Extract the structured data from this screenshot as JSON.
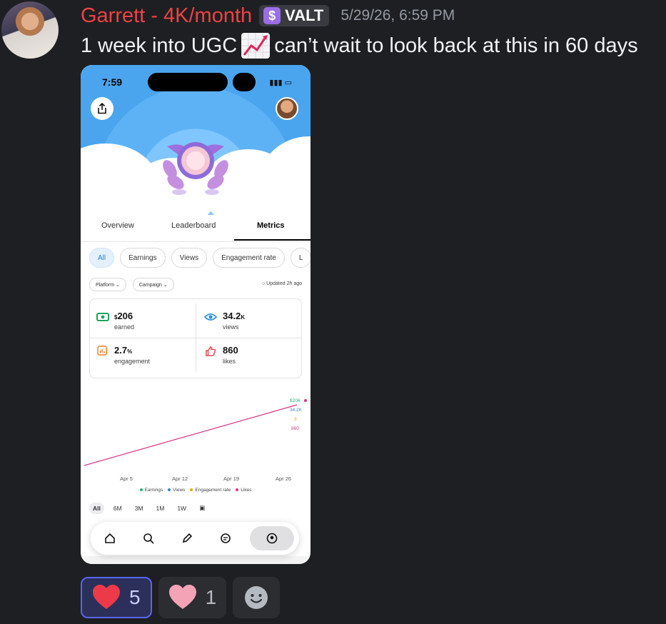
{
  "author": {
    "name": "Garrett - 4K/month",
    "tag": "VALT",
    "tag_icon": "server-tag-icon",
    "timestamp": "5/29/26, 6:59 PM"
  },
  "message": {
    "text_before": "1 week into UGC",
    "emoji": "chart-increasing-emoji",
    "text_after": "can’t wait to look back at this in 60 days"
  },
  "phone": {
    "status": {
      "time": "7:59"
    },
    "tabs": [
      "Overview",
      "Leaderboard",
      "Metrics"
    ],
    "active_tab": "Metrics",
    "chips": [
      "All",
      "Earnings",
      "Views",
      "Engagement rate"
    ],
    "filters": {
      "platform": "Platform ⌄",
      "campaign": "Campaign ⌄",
      "updated": "Updated 2h ago"
    },
    "stats": {
      "earnings": {
        "prefix": "$",
        "value": "206",
        "label": "earned"
      },
      "views": {
        "value": "34.2",
        "suffix": "K",
        "label": "views"
      },
      "engagement": {
        "value": "2.7",
        "suffix": "%",
        "label": "engagement"
      },
      "likes": {
        "value": "860",
        "label": "likes"
      }
    },
    "chart_data": {
      "type": "line",
      "x_ticks": [
        "Apr 5",
        "Apr 12",
        "Apr 19",
        "Apr 26"
      ],
      "end_labels": {
        "earnings": "$206",
        "views": "34.2K",
        "engagement": "3",
        "likes": "860"
      },
      "series": [
        {
          "name": "Earnings",
          "color": "#22b573"
        },
        {
          "name": "Views",
          "color": "#3b7ddd"
        },
        {
          "name": "Engagement rate",
          "color": "#f0a500"
        },
        {
          "name": "Likes",
          "color": "#d63384"
        }
      ]
    },
    "ranges": [
      "All",
      "6M",
      "3M",
      "1M",
      "1W"
    ],
    "nav_icons": [
      "home-icon",
      "search-icon",
      "pen-icon",
      "chat-icon",
      "profile-icon"
    ]
  },
  "reactions": [
    {
      "emoji": "red-heart",
      "count": "5",
      "color": "#ed3a48"
    },
    {
      "emoji": "pink-heart",
      "count": "1",
      "color": "#f4a3b6"
    }
  ]
}
